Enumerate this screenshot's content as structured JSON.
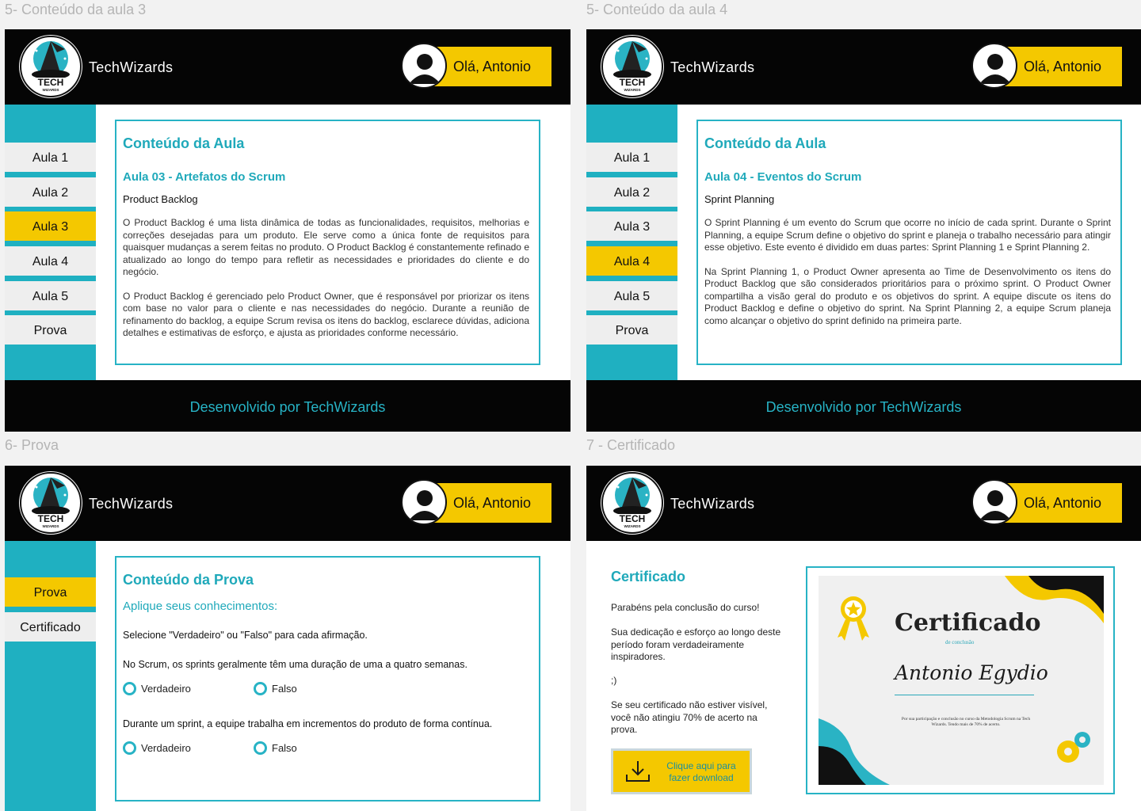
{
  "frames": [
    {
      "label": "5- Conteúdo da aula 3",
      "brand": "TechWizards",
      "greeting": "Olá, Antonio",
      "nav": [
        "Aula 1",
        "Aula 2",
        "Aula 3",
        "Aula 4",
        "Aula 5",
        "Prova"
      ],
      "active_nav": "Aula 3",
      "content_title": "Conteúdo da Aula",
      "lesson_title": "Aula 03 - Artefatos do Scrum",
      "sub_title": "Product Backlog",
      "paragraphs": [
        "O Product Backlog é uma lista dinâmica de todas as funcionalidades, requisitos, melhorias e correções desejadas para um produto. Ele serve como a única fonte de requisitos para quaisquer mudanças a serem feitas no produto. O Product Backlog é constantemente refinado e atualizado ao longo do tempo para refletir as necessidades e prioridades do cliente e do negócio.",
        "O Product Backlog é gerenciado pelo Product Owner, que é responsável por priorizar os itens com base no valor para o cliente e nas necessidades do negócio. Durante a reunião de refinamento do backlog, a equipe Scrum revisa os itens do backlog, esclarece dúvidas, adiciona detalhes e estimativas de esforço, e ajusta as prioridades conforme necessário."
      ],
      "footer": "Desenvolvido por TechWizards"
    },
    {
      "label": "5- Conteúdo da aula 4",
      "brand": "TechWizards",
      "greeting": "Olá, Antonio",
      "nav": [
        "Aula 1",
        "Aula 2",
        "Aula 3",
        "Aula 4",
        "Aula 5",
        "Prova"
      ],
      "active_nav": "Aula 4",
      "content_title": "Conteúdo da Aula",
      "lesson_title": "Aula 04 - Eventos do Scrum",
      "sub_title": "Sprint Planning",
      "paragraphs": [
        "O Sprint Planning é um evento do Scrum que ocorre no início de cada sprint. Durante o Sprint Planning, a equipe Scrum define o objetivo do sprint e planeja o trabalho necessário para atingir esse objetivo. Este evento é dividido em duas partes: Sprint Planning 1 e Sprint Planning 2.",
        "Na Sprint Planning 1, o Product Owner apresenta ao Time de Desenvolvimento os itens do Product Backlog que são considerados prioritários para o próximo sprint. O Product Owner compartilha a visão geral do produto e os objetivos do sprint. A equipe discute os itens do Product Backlog e define o objetivo do sprint. Na Sprint Planning 2, a equipe Scrum planeja como alcançar o objetivo do sprint definido na primeira parte."
      ],
      "footer": "Desenvolvido por TechWizards"
    },
    {
      "label": "6- Prova",
      "brand": "TechWizards",
      "greeting": "Olá, Antonio",
      "nav": [
        "Prova",
        "Certificado"
      ],
      "active_nav": "Prova",
      "content_title": "Conteúdo da Prova",
      "quiz_subtitle": "Aplique seus conhecimentos:",
      "instruction": "Selecione \"Verdadeiro\" ou \"Falso\" para cada afirmação.",
      "questions": [
        {
          "text": "No Scrum, os sprints geralmente têm uma duração de uma a quatro semanas.",
          "options": [
            "Verdadeiro",
            "Falso"
          ]
        },
        {
          "text": "Durante um sprint, a equipe trabalha em incrementos do produto de forma contínua.",
          "options": [
            "Verdadeiro",
            "Falso"
          ]
        }
      ]
    },
    {
      "label": "7 - Certificado",
      "brand": "TechWizards",
      "greeting": "Olá, Antonio",
      "heading": "Certificado",
      "congrats": "Parabéns pela conclusão do curso!",
      "dedication": "Sua dedicação e esforço ao longo deste período foram verdadeiramente inspiradores.",
      "wink": ";)",
      "notice": "Se seu certificado não estiver visível, você não atingiu 70% de acerto na prova.",
      "download_label": "Clique aqui para fazer download",
      "certificate": {
        "title": "Certificado",
        "subtitle": "de conclusão",
        "name": "Antonio Egydio",
        "description": "Por sua participação e conclusão no curso da Metodologia Scrum na Tech Wizards. Tendo mais de 70% de acerto."
      }
    }
  ],
  "logo_text": "TECH",
  "logo_small": "WIZARDS",
  "colors": {
    "teal": "#1fb0c1",
    "yellow": "#f4c800",
    "black": "#050505",
    "nav_bg": "#eeeeee"
  },
  "icons": {
    "logo": "wizard-hat-logo",
    "user": "user-avatar-icon",
    "download": "download-icon",
    "radio": "radio-button"
  }
}
